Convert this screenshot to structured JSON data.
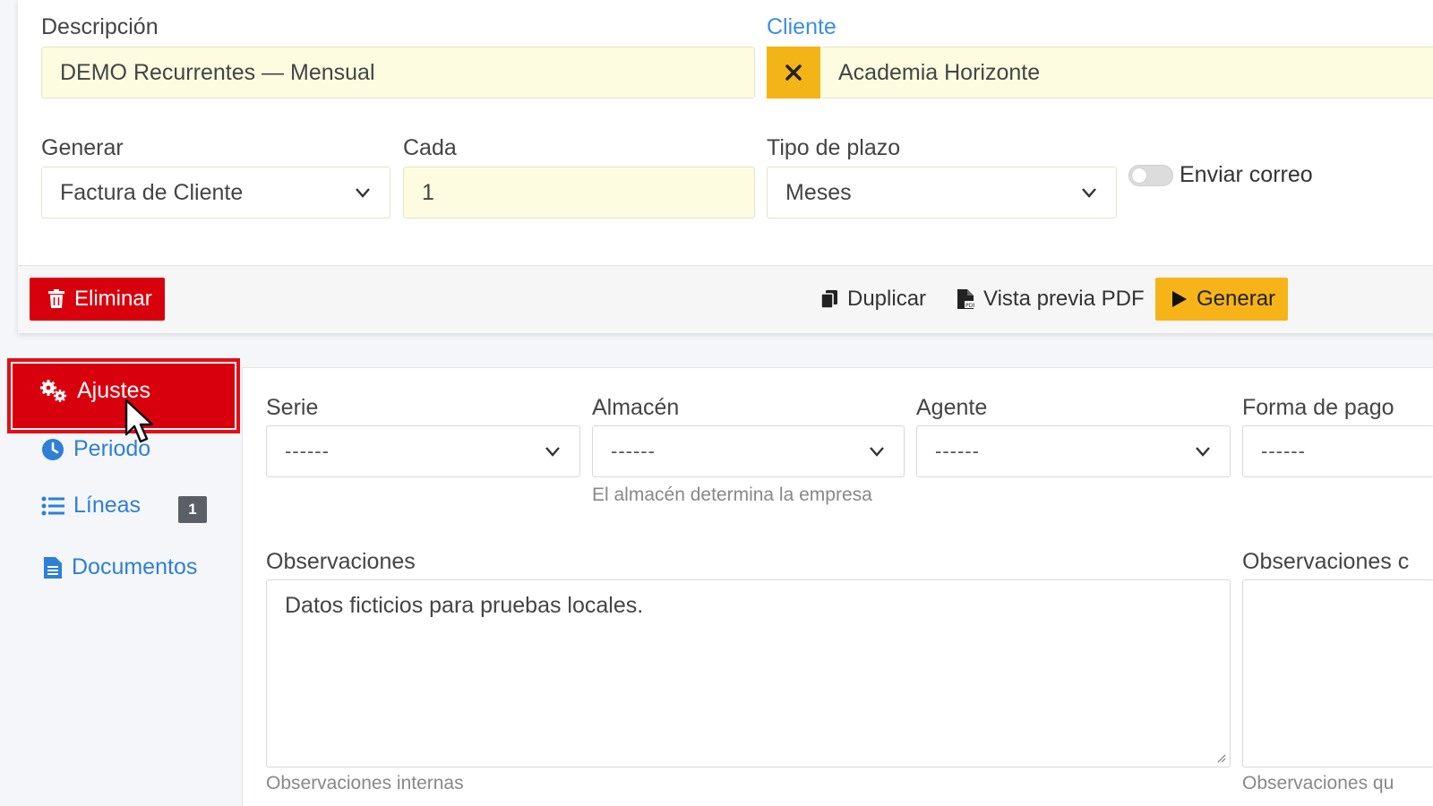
{
  "form": {
    "descripcion_label": "Descripción",
    "descripcion_value": "DEMO Recurrentes — Mensual",
    "cliente_label": "Cliente",
    "cliente_value": "Academia Horizonte",
    "generar_label": "Generar",
    "generar_value": "Factura de Cliente",
    "cada_label": "Cada",
    "cada_value": "1",
    "tipo_plazo_label": "Tipo de plazo",
    "tipo_plazo_value": "Meses",
    "enviar_correo_label": "Enviar correo",
    "enviar_correo_on": false
  },
  "actions": {
    "eliminar": "Eliminar",
    "duplicar": "Duplicar",
    "vista_previa": "Vista previa PDF",
    "generar": "Generar"
  },
  "sidebar": {
    "items": [
      {
        "label": "Ajustes",
        "icon": "gears-icon",
        "active": true
      },
      {
        "label": "Periodo",
        "icon": "clock-icon"
      },
      {
        "label": "Líneas",
        "icon": "list-icon",
        "badge": "1"
      },
      {
        "label": "Documentos",
        "icon": "document-icon"
      }
    ]
  },
  "settings": {
    "serie_label": "Serie",
    "serie_value": "------",
    "almacen_label": "Almacén",
    "almacen_value": "------",
    "almacen_help": "El almacén determina la empresa",
    "agente_label": "Agente",
    "agente_value": "------",
    "forma_pago_label": "Forma de pago",
    "forma_pago_value": "------",
    "observaciones_label": "Observaciones",
    "observaciones_value": "Datos ficticios para pruebas locales.",
    "observaciones_help": "Observaciones internas",
    "observaciones2_label": "Observaciones c",
    "observaciones2_help": "Observaciones qu"
  },
  "colors": {
    "danger": "#d9000d",
    "warning": "#f6b418",
    "link": "#2f7fd6",
    "field_yellow": "#fdfce0"
  }
}
